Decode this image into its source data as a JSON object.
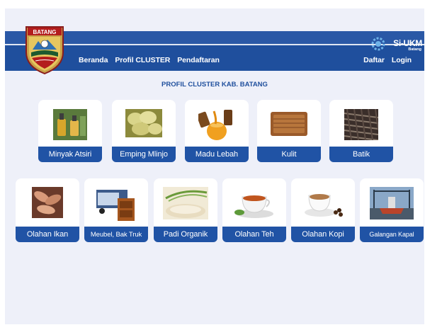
{
  "header": {
    "logo_text": "BATANG",
    "brand_title": "Si-UKM",
    "brand_subtitle": "Batang",
    "nav_left": [
      "Beranda",
      "Profil CLUSTER",
      "Pendaftaran"
    ],
    "nav_right": [
      "Daftar",
      "Login"
    ],
    "colors": {
      "primary": "#2a58a6",
      "label": "#2053a5",
      "background": "#eef0f9"
    }
  },
  "main": {
    "title": "PROFIL CLUSTER KAB. BATANG",
    "clusters_row1": [
      {
        "label": "Minyak Atsiri",
        "icon": "essential-oil-bottles"
      },
      {
        "label": "Emping Mlinjo",
        "icon": "emping-chips"
      },
      {
        "label": "Madu Lebah",
        "icon": "honey-jar"
      },
      {
        "label": "Kulit",
        "icon": "leather-wallet"
      },
      {
        "label": "Batik",
        "icon": "batik-cloth"
      }
    ],
    "clusters_row2": [
      {
        "label": "Olahan Ikan",
        "icon": "fish"
      },
      {
        "label": "Meubel, Bak Truk",
        "icon": "truck-furniture"
      },
      {
        "label": "Padi Organik",
        "icon": "rice"
      },
      {
        "label": "Olahan Teh",
        "icon": "tea-cup"
      },
      {
        "label": "Olahan Kopi",
        "icon": "coffee-cup"
      },
      {
        "label": "Galangan Kapal",
        "icon": "shipyard"
      }
    ]
  }
}
